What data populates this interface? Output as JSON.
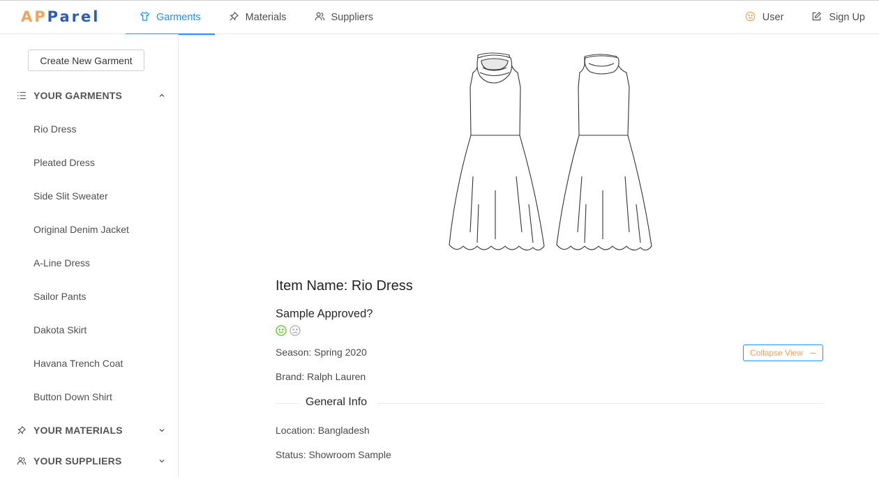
{
  "app": {
    "logo_prefix": "AP",
    "logo_rest": "Parel"
  },
  "nav": {
    "garments": "Garments",
    "materials": "Materials",
    "suppliers": "Suppliers",
    "user": "User",
    "signup": "Sign Up"
  },
  "sidebar": {
    "create_button": "Create New Garment",
    "your_garments": "YOUR GARMENTS",
    "your_materials": "YOUR MATERIALS",
    "your_suppliers": "YOUR SUPPLIERS",
    "garments": [
      "Rio Dress",
      "Pleated Dress",
      "Side Slit Sweater",
      "Original Denim Jacket",
      "A-Line Dress",
      "Sailor Pants",
      "Dakota Skirt",
      "Havana Trench Coat",
      "Button Down Shirt"
    ]
  },
  "detail": {
    "item_name": "Item Name: Rio Dress",
    "sample_approved": "Sample Approved?",
    "season": "Season: Spring 2020",
    "brand": "Brand: Ralph Lauren",
    "collapse_button": "Collapse View",
    "general_info": "General Info",
    "location": "Location: Bangladesh",
    "status": "Status: Showroom Sample"
  },
  "colors": {
    "accent": "#1890ff",
    "logo_orange": "#f0a35e",
    "logo_blue": "#2a5cb8",
    "approve_green": "#52c41a"
  },
  "icons": {
    "garments_nav": "shirt-icon",
    "materials_nav": "pushpin-icon",
    "suppliers_nav": "team-icon",
    "user_nav": "smile-icon",
    "signup_nav": "edit-icon"
  }
}
